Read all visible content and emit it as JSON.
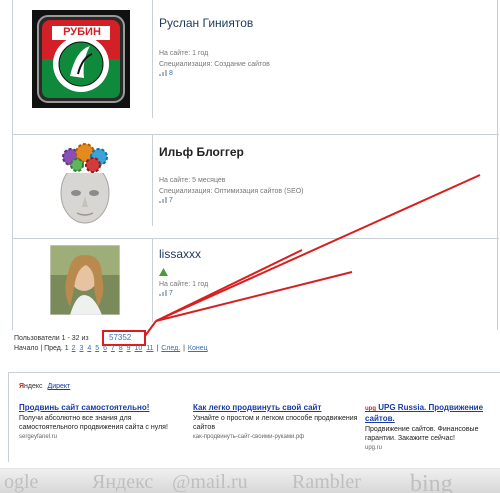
{
  "users": [
    {
      "name": "Руслан Гиниятов",
      "online": "На сайте: 1 год",
      "spec": "Специализация: Создание сайтов",
      "rating": "8",
      "logo_text": "РУБИН"
    },
    {
      "name": "Ильф Блоггер",
      "online": "На сайте: 5 месяцев",
      "spec": "Специализация: Оптимизация сайтов (SEO)",
      "rating": "7"
    },
    {
      "name": "lissaxxx",
      "online": "На сайте: 1 год",
      "spec": "",
      "rating": "7"
    }
  ],
  "pager": {
    "summary": "Пользователи 1 - 32 из",
    "total": "57352",
    "start": "Начало",
    "prev": "Пред.",
    "current": "1",
    "pages": [
      "2",
      "3",
      "4",
      "5",
      "6",
      "7",
      "8",
      "9",
      "10",
      "11"
    ],
    "next": "След.",
    "end": "Конец"
  },
  "ads": {
    "ya": "Я",
    "yandex_rest": "ндекс",
    "direct": "Директ",
    "items": [
      {
        "title": "Продвинь сайт самостоятельно!",
        "text": "Получи абсолютно все знания для самостоятельного продвижения сайта с нуля!",
        "url": "sergeyfanel.ru",
        "pre": ""
      },
      {
        "title": "Как легко продвинуть свой сайт",
        "text": "Узнайте о простом и легком способе продвижения сайтов",
        "url": "как-продвинуть-сайт-своими-руками.рф",
        "pre": ""
      },
      {
        "title": "UPG Russia. Продвижение сайтов.",
        "text": "Продвижение сайтов. Финансовые гарантии. Закажите сейчас!",
        "url": "upg.ru",
        "pre": "upg"
      }
    ]
  },
  "search_engines": [
    "ogle",
    "Яндекс",
    "@mail.ru",
    "Rambler",
    "bing"
  ],
  "colors": {
    "annotation_red": "#d81e1e",
    "link_blue": "#3a6fb0"
  }
}
